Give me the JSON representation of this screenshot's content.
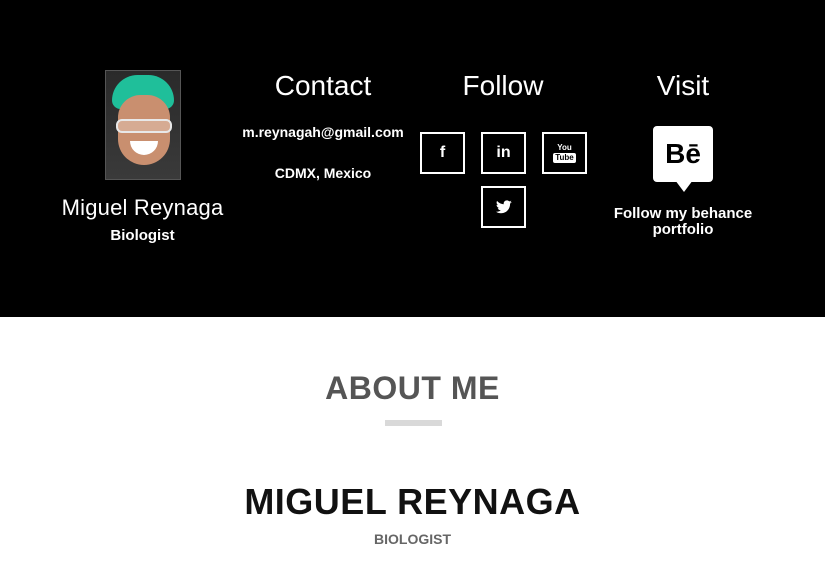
{
  "profile": {
    "name": "Miguel Reynaga",
    "role": "Biologist",
    "photo_icon": "portrait-photo"
  },
  "contact": {
    "title": "Contact",
    "email": "m.reynagah@gmail.com",
    "location": "CDMX, Mexico"
  },
  "follow": {
    "title": "Follow",
    "networks": [
      {
        "name": "facebook",
        "icon": "facebook-icon",
        "glyph": "f"
      },
      {
        "name": "linkedin",
        "icon": "linkedin-icon",
        "glyph": "in"
      },
      {
        "name": "youtube",
        "icon": "youtube-icon",
        "glyph_top": "You",
        "glyph_bottom": "Tube"
      },
      {
        "name": "twitter",
        "icon": "twitter-icon",
        "glyph": "🐦"
      }
    ]
  },
  "visit": {
    "title": "Visit",
    "badge_glyph": "Bē",
    "badge_icon": "behance-icon",
    "text": "Follow my behance portfolio"
  },
  "about": {
    "title": "ABOUT ME",
    "name": "MIGUEL REYNAGA",
    "role": "BIOLOGIST"
  },
  "colors": {
    "header_bg": "#000000",
    "header_text": "#ffffff",
    "about_title": "#555555",
    "divider": "#d9d9d9",
    "name_text": "#111111"
  }
}
